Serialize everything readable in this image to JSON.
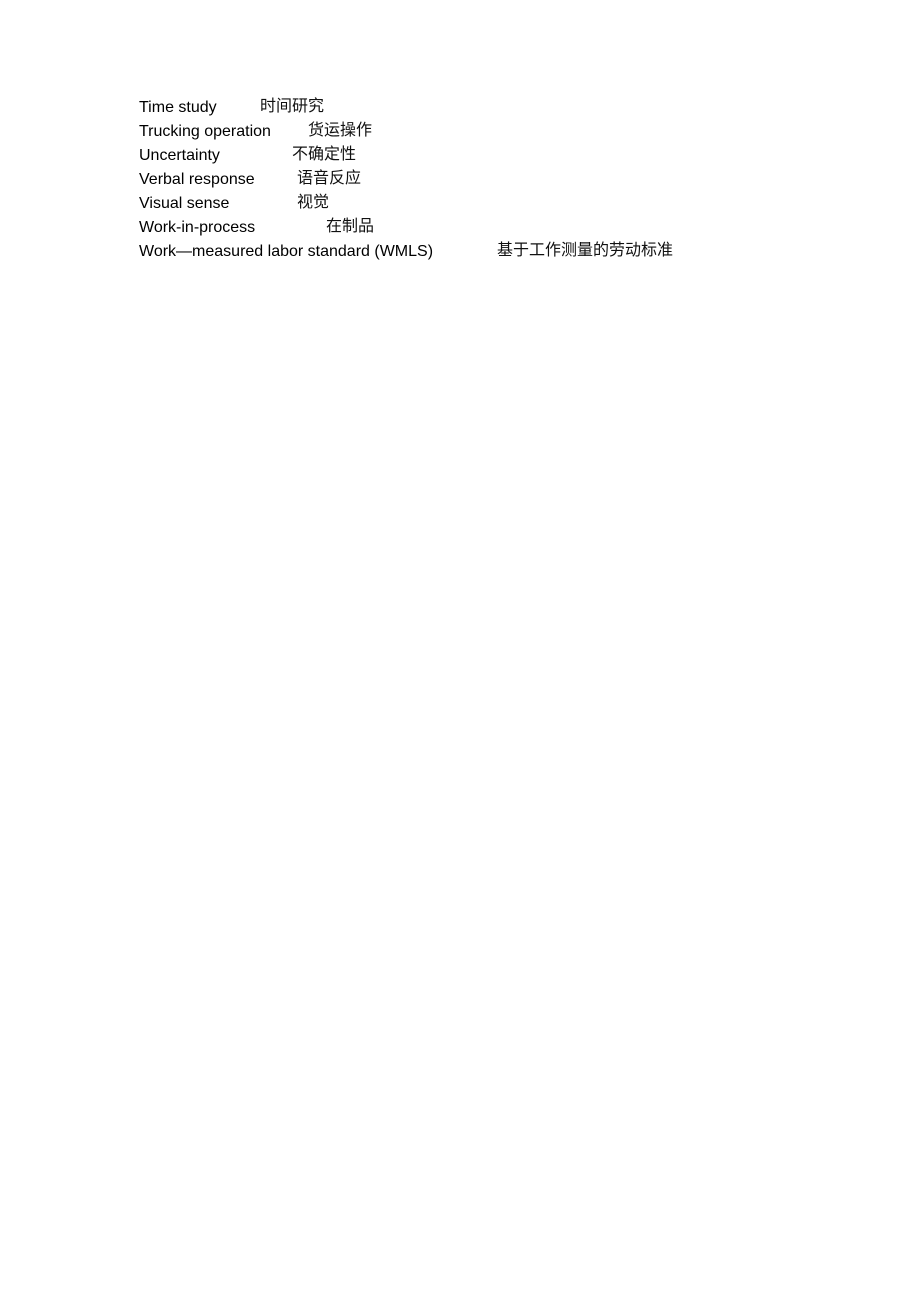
{
  "document": {
    "glossary": [
      {
        "english": "Time study",
        "chinese": "时间研究"
      },
      {
        "english": "Trucking operation",
        "chinese": "货运操作"
      },
      {
        "english": "Uncertainty",
        "chinese": "不确定性"
      },
      {
        "english": "Verbal response",
        "chinese": "语音反应"
      },
      {
        "english": "Visual sense",
        "chinese": "视觉"
      },
      {
        "english": "Work-in-process",
        "chinese": "在制品"
      },
      {
        "english": "Work—measured labor standard (WMLS)",
        "chinese": "基于工作测量的劳动标准"
      }
    ]
  }
}
